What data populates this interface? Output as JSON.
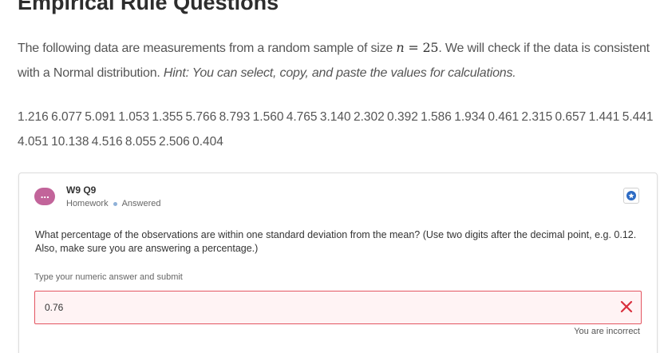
{
  "page": {
    "title": "Empirical Rule Questions"
  },
  "intro": {
    "text_before": "The following data are measurements from a random sample of size ",
    "math_var": "n",
    "math_eq": " = ",
    "math_num": "25",
    "text_after": ". We will check if the data is consistent with a Normal distribution. ",
    "hint": "Hint: You can select, copy, and paste the values for calculations."
  },
  "data_values": "1.216 6.077 5.091 1.053 1.355 5.766 8.793 1.560 4.765 3.140 2.302 0.392 1.586 1.934 0.461 2.315 0.657 1.441 5.441 4.051 10.138 4.516 8.055 2.506 0.404",
  "card": {
    "avatar_icon": "chat-bubble-icon",
    "avatar_glyph": "...",
    "avatar_color": "#c2649a",
    "title": "W9 Q9",
    "type": "Homework",
    "status": "Answered",
    "bookmark_icon": "star-icon",
    "question": "What percentage of the observations are within one standard deviation from the mean? (Use two digits after the decimal point, e.g. 0.12. Also, make sure you are answering a percentage.)",
    "answer_label": "Type your numeric answer and submit",
    "answer_value": "0.76",
    "incorrect_icon": "close-x-icon",
    "error_color": "#e35561",
    "feedback": "You are incorrect"
  }
}
